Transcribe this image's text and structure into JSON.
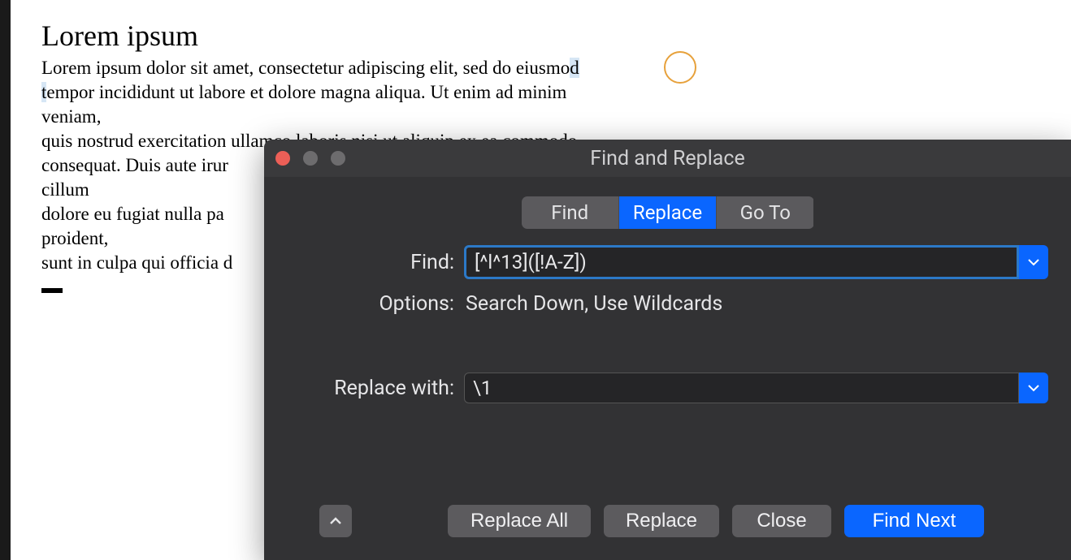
{
  "document": {
    "title": "Lorem ipsum",
    "line1a": "Lorem ipsum dolor sit amet, consectetur adipiscing elit, sed do eiusmo",
    "line1_sel": "d ",
    "line2_sel": "t",
    "line2a": "empor incididunt ut labore et dolore magna aliqua. Ut enim ad minim",
    "line3": "veniam,",
    "line4": "quis nostrud exercitation ullamco laboris nisi ut aliquip ex ea commodo",
    "line5": "consequat. Duis aute irur",
    "line6": "cillum",
    "line7": "dolore eu fugiat nulla pa",
    "line8": "proident,",
    "line9": "sunt in culpa qui officia d"
  },
  "dialog": {
    "title": "Find and Replace",
    "tabs": {
      "find": "Find",
      "replace": "Replace",
      "goto": "Go To"
    },
    "labels": {
      "find": "Find:",
      "options": "Options:",
      "replace_with": "Replace with:"
    },
    "values": {
      "find_input": "[^l^13]([!A-Z])",
      "options_text": "Search Down, Use Wildcards",
      "replace_input": "\\1"
    },
    "buttons": {
      "replace_all": "Replace All",
      "replace": "Replace",
      "close": "Close",
      "find_next": "Find Next"
    }
  }
}
